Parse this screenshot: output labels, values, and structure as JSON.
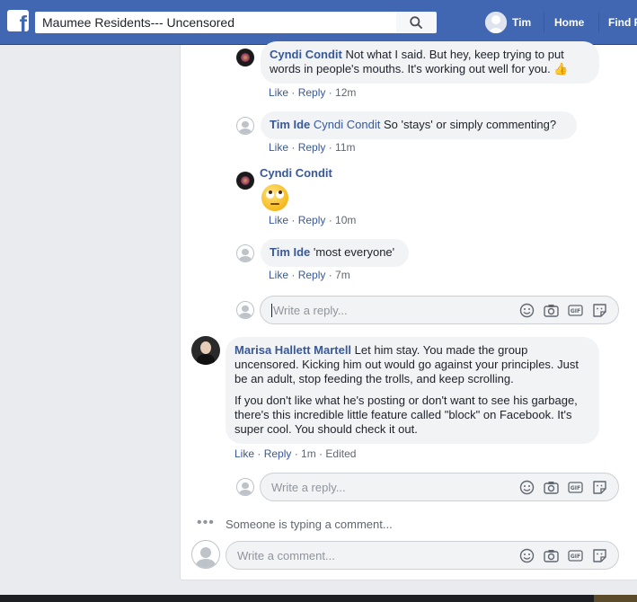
{
  "header": {
    "group_name": "Maumee Residents--- Uncensored",
    "user_name": "Tim",
    "nav_home": "Home",
    "nav_find": "Find F"
  },
  "comments": [
    {
      "author": "Cyndi Condit",
      "text": "Not what I said. But hey, keep trying to put words in people's mouths. It's working out well for you. 👍",
      "like": "Like",
      "reply": "Reply",
      "time": "12m"
    },
    {
      "author": "Tim Ide",
      "tag": "Cyndi Condit",
      "text": "So 'stays' or simply commenting?",
      "like": "Like",
      "reply": "Reply",
      "time": "11m"
    },
    {
      "author": "Cyndi Condit",
      "emoji": "eye-roll-emoji",
      "like": "Like",
      "reply": "Reply",
      "time": "10m"
    },
    {
      "author": "Tim Ide",
      "text": "'most everyone'",
      "like": "Like",
      "reply": "Reply",
      "time": "7m"
    },
    {
      "author": "Marisa Hallett Martell",
      "text": "Let him stay. You made the group uncensored. Kicking him out would go against your principles. Just be an adult, stop feeding the trolls, and keep scrolling.",
      "text2": "If you don't like what he's posting or don't want to see his garbage, there's this incredible little feature called \"block\" on Facebook. It's super cool. You should check it out.",
      "like": "Like",
      "reply": "Reply",
      "time": "1m",
      "edited": "Edited"
    }
  ],
  "inputs": {
    "reply_placeholder": "Write a reply...",
    "comment_placeholder": "Write a comment..."
  },
  "typing_indicator": "Someone is typing a comment...",
  "colors": {
    "topbar": "#4267b2",
    "link": "#385898",
    "bubble": "#f2f3f5",
    "page_bg": "#e9ebee"
  }
}
